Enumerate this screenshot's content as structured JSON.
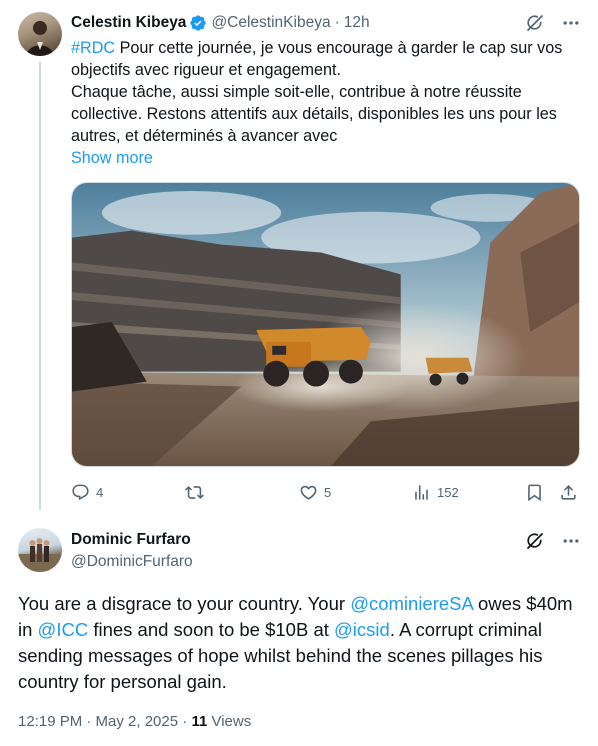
{
  "colors": {
    "link": "#1d9bf0",
    "text": "#0f1419",
    "muted": "#536471",
    "verified": "#1d9bf0"
  },
  "tweet": {
    "author_name": "Celestin Kibeya",
    "author_handle": "@CelestinKibeya",
    "time": "12h",
    "hashtag": "#RDC",
    "text_line1_rest": " Pour cette  journée, je vous encourage à garder le cap sur vos objectifs avec rigueur et engagement.",
    "text_rest": "Chaque tâche, aussi simple soit-elle, contribue à notre réussite collective. Restons attentifs aux détails, disponibles les uns pour les autres, et déterminés à avancer avec",
    "show_more": "Show more",
    "icons": {
      "grok": "grok-icon",
      "more": "more-icon"
    },
    "media": {
      "description_icon": "image"
    },
    "actions": {
      "replies": "4",
      "retweets": "",
      "likes": "5",
      "views": "152"
    }
  },
  "reply": {
    "author_name": "Dominic Furfaro",
    "author_handle": "@DominicFurfaro",
    "text_1": "You are a disgrace to your country. Your ",
    "mention_1": "@cominiereSA",
    "text_2": " owes $40m in ",
    "mention_2": "@ICC",
    "text_3": " fines and soon to be $10B at ",
    "mention_3": "@icsid",
    "text_4": ". A corrupt criminal sending messages of hope whilst behind the scenes pillages his country for personal gain.",
    "timestamp": "12:19 PM · May 2, 2025",
    "separator": " · ",
    "views_count": "11",
    "views_label": " Views"
  }
}
